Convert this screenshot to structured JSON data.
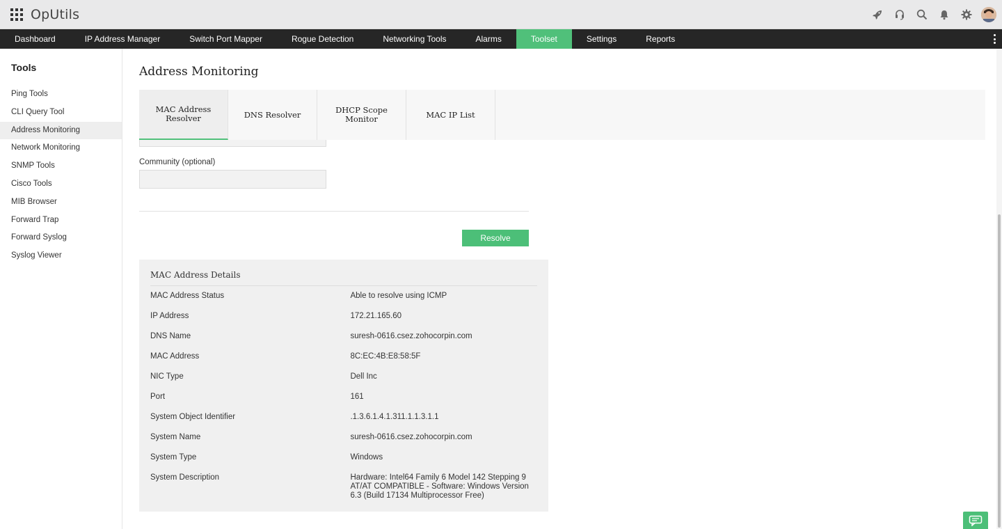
{
  "header": {
    "app_title": "OpUtils",
    "icons": [
      "apps-grid-icon",
      "rocket-icon",
      "headset-icon",
      "search-icon",
      "bell-icon",
      "gear-icon",
      "avatar"
    ]
  },
  "nav": {
    "items": [
      "Dashboard",
      "IP Address Manager",
      "Switch Port Mapper",
      "Rogue Detection",
      "Networking Tools",
      "Alarms",
      "Toolset",
      "Settings",
      "Reports"
    ],
    "active": "Toolset",
    "accent_color": "#50c07a"
  },
  "sidebar": {
    "title": "Tools",
    "items": [
      "Ping Tools",
      "CLI Query Tool",
      "Address Monitoring",
      "Network Monitoring",
      "SNMP Tools",
      "Cisco Tools",
      "MIB Browser",
      "Forward Trap",
      "Forward Syslog",
      "Syslog Viewer"
    ],
    "active": "Address Monitoring"
  },
  "main": {
    "page_title": "Address Monitoring",
    "tabs": [
      "MAC Address Resolver",
      "DNS Resolver",
      "DHCP Scope Monitor",
      "MAC IP List"
    ],
    "active_tab": "MAC Address Resolver",
    "community_label": "Community (optional)",
    "community_value": "",
    "resolve_label": "Resolve"
  },
  "details": {
    "title": "MAC Address Details",
    "rows": [
      {
        "key": "MAC Address Status",
        "value": "Able to resolve using ICMP"
      },
      {
        "key": "IP Address",
        "value": "172.21.165.60"
      },
      {
        "key": "DNS Name",
        "value": "suresh-0616.csez.zohocorpin.com"
      },
      {
        "key": "MAC Address",
        "value": "8C:EC:4B:E8:58:5F"
      },
      {
        "key": "NIC Type",
        "value": "Dell Inc"
      },
      {
        "key": "Port",
        "value": "161"
      },
      {
        "key": "System Object Identifier",
        "value": ".1.3.6.1.4.1.311.1.1.3.1.1"
      },
      {
        "key": "System Name",
        "value": "suresh-0616.csez.zohocorpin.com"
      },
      {
        "key": "System Type",
        "value": "Windows"
      },
      {
        "key": "System Description",
        "value": "Hardware: Intel64 Family 6 Model 142 Stepping 9 AT/AT COMPATIBLE - Software: Windows Version 6.3 (Build 17134 Multiprocessor Free)"
      }
    ]
  }
}
